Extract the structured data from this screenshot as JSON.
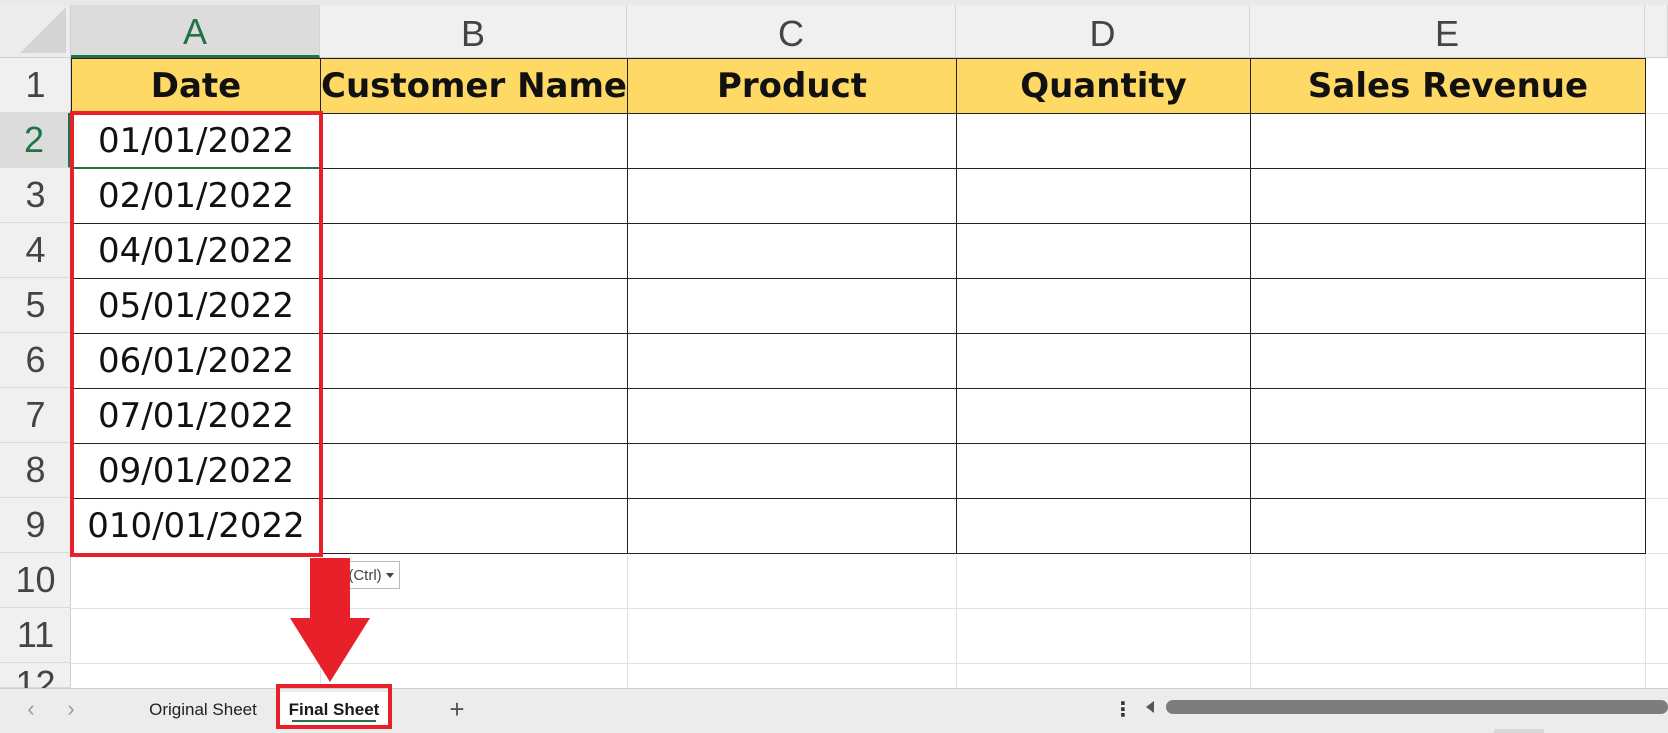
{
  "columns": [
    {
      "letter": "A"
    },
    {
      "letter": "B"
    },
    {
      "letter": "C"
    },
    {
      "letter": "D"
    },
    {
      "letter": "E"
    }
  ],
  "row_numbers": [
    "1",
    "2",
    "3",
    "4",
    "5",
    "6",
    "7",
    "8",
    "9",
    "10",
    "11",
    "12"
  ],
  "table": {
    "headers": [
      "Date",
      "Customer Name",
      "Product",
      "Quantity",
      "Sales Revenue"
    ],
    "dates": [
      "01/01/2022",
      "02/01/2022",
      "04/01/2022",
      "05/01/2022",
      "06/01/2022",
      "07/01/2022",
      "09/01/2022",
      "010/01/2022"
    ]
  },
  "selection": {
    "active_cell": "A2",
    "selected_column": "A",
    "selected_row": "2"
  },
  "paste_options": {
    "label": "(Ctrl)"
  },
  "sheet_tabs": [
    {
      "label": "Original Sheet",
      "active": false
    },
    {
      "label": "Final Sheet",
      "active": true
    }
  ],
  "annotation_colors": {
    "highlight": "#e8202a",
    "header_fill": "#ffd966",
    "accent": "#217346"
  },
  "icons": {
    "prev_sheet": "chevron-left-icon",
    "next_sheet": "chevron-right-icon",
    "add_sheet": "plus-icon",
    "more": "vertical-ellipsis-icon",
    "scroll_left": "triangle-left-icon"
  }
}
